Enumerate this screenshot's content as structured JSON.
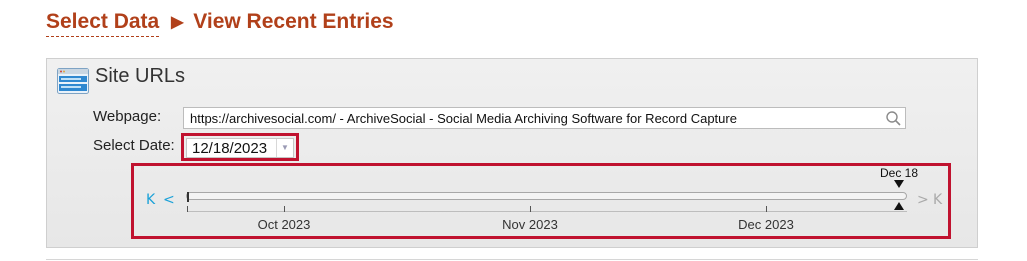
{
  "breadcrumb": {
    "parent": "Select Data",
    "separator": "▶",
    "current": "View Recent Entries"
  },
  "panel": {
    "title": "Site URLs",
    "icon": "window-list-icon"
  },
  "webpage": {
    "label": "Webpage:",
    "value": "https://archivesocial.com/ - ArchiveSocial - Social Media Archiving Software for Record Capture",
    "search_icon": "search-icon"
  },
  "date": {
    "label": "Select Date:",
    "value": "12/18/2023",
    "dropdown_icon": "chevron-down-icon"
  },
  "timeline": {
    "nav": {
      "first": "K",
      "prev": "<",
      "next": ">",
      "last": "K"
    },
    "months": [
      "Oct 2023",
      "Nov 2023",
      "Dec 2023"
    ],
    "selected_label": "Dec 18",
    "colors": {
      "nav_active": "#1aa1d8",
      "nav_disabled": "#aaaaaa",
      "highlight": "#c0122f"
    }
  }
}
